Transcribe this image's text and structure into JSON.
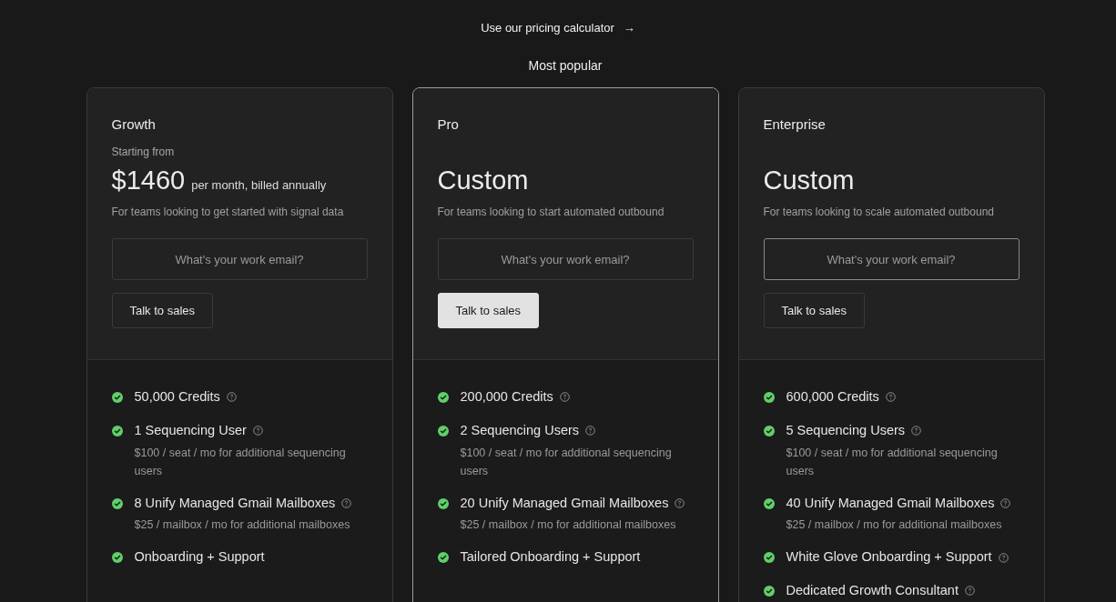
{
  "calculator_link": {
    "label": "Use our pricing calculator",
    "arrow": "→"
  },
  "plans": [
    {
      "name": "Growth",
      "highlighted": false,
      "starting_label": "Starting from",
      "price": "$1460",
      "price_suffix": "per month, billed annually",
      "description": "For teams looking to get started with signal data",
      "email_field": {
        "placeholder": "What's your work email?",
        "focused": false
      },
      "button": {
        "label": "Talk to sales",
        "kind": "outline"
      },
      "features": [
        {
          "text": "50,000 Credits",
          "info": true
        },
        {
          "text": "1 Sequencing User",
          "info": true,
          "note": "$100 / seat / mo for additional sequencing users"
        },
        {
          "text": "8 Unify Managed Gmail Mailboxes",
          "info": true,
          "note": "$25 / mailbox / mo for additional mailboxes"
        },
        {
          "text": "Onboarding + Support",
          "info": false
        }
      ]
    },
    {
      "name": "Pro",
      "badge": "Most popular",
      "highlighted": true,
      "price": "Custom",
      "description": "For teams looking to start automated outbound",
      "email_field": {
        "placeholder": "What's your work email?",
        "focused": false
      },
      "button": {
        "label": "Talk to sales",
        "kind": "filled"
      },
      "features": [
        {
          "text": "200,000 Credits",
          "info": true
        },
        {
          "text": "2 Sequencing Users",
          "info": true,
          "note": "$100 / seat / mo for additional sequencing users"
        },
        {
          "text": "20 Unify Managed Gmail Mailboxes",
          "info": true,
          "note": "$25 / mailbox / mo for additional mailboxes"
        },
        {
          "text": "Tailored Onboarding + Support",
          "info": false
        }
      ]
    },
    {
      "name": "Enterprise",
      "highlighted": false,
      "price": "Custom",
      "description": "For teams looking to scale automated outbound",
      "email_field": {
        "placeholder": "What's your work email?",
        "focused": true
      },
      "button": {
        "label": "Talk to sales",
        "kind": "outline"
      },
      "features": [
        {
          "text": "600,000 Credits",
          "info": true
        },
        {
          "text": "5 Sequencing Users",
          "info": true,
          "note": "$100 / seat / mo for additional sequencing users"
        },
        {
          "text": "40 Unify Managed Gmail Mailboxes",
          "info": true,
          "note": "$25 / mailbox / mo for additional mailboxes"
        },
        {
          "text": "White Glove Onboarding + Support",
          "info": true
        },
        {
          "text": "Dedicated Growth Consultant",
          "info": true
        }
      ]
    }
  ]
}
